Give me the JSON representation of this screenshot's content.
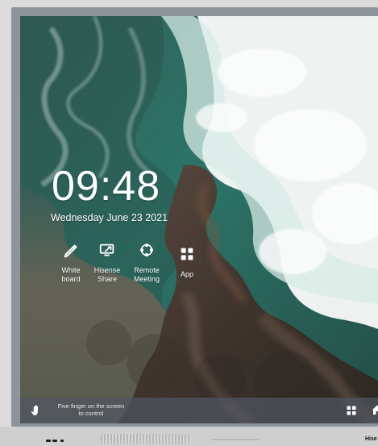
{
  "home": {
    "time": "09:48",
    "date": "Wednesday June 23 2021",
    "apps": [
      {
        "label": "White\nboard",
        "icon": "pen-icon"
      },
      {
        "label": "Hisense\nShare",
        "icon": "screen-share-icon"
      },
      {
        "label": "Remote\nMeeting",
        "icon": "meeting-icon"
      },
      {
        "label": "App",
        "icon": "app-grid-icon"
      }
    ]
  },
  "taskbar": {
    "hint": "Five finger on the screen\nto control",
    "left_icon": "hand-icon",
    "right_icons": [
      "apps-grid-icon",
      "home-icon"
    ]
  },
  "device": {
    "brand": "Hise"
  },
  "colors": {
    "bezel": "#8f949b",
    "taskbar": "#505662",
    "text": "#ffffff"
  }
}
